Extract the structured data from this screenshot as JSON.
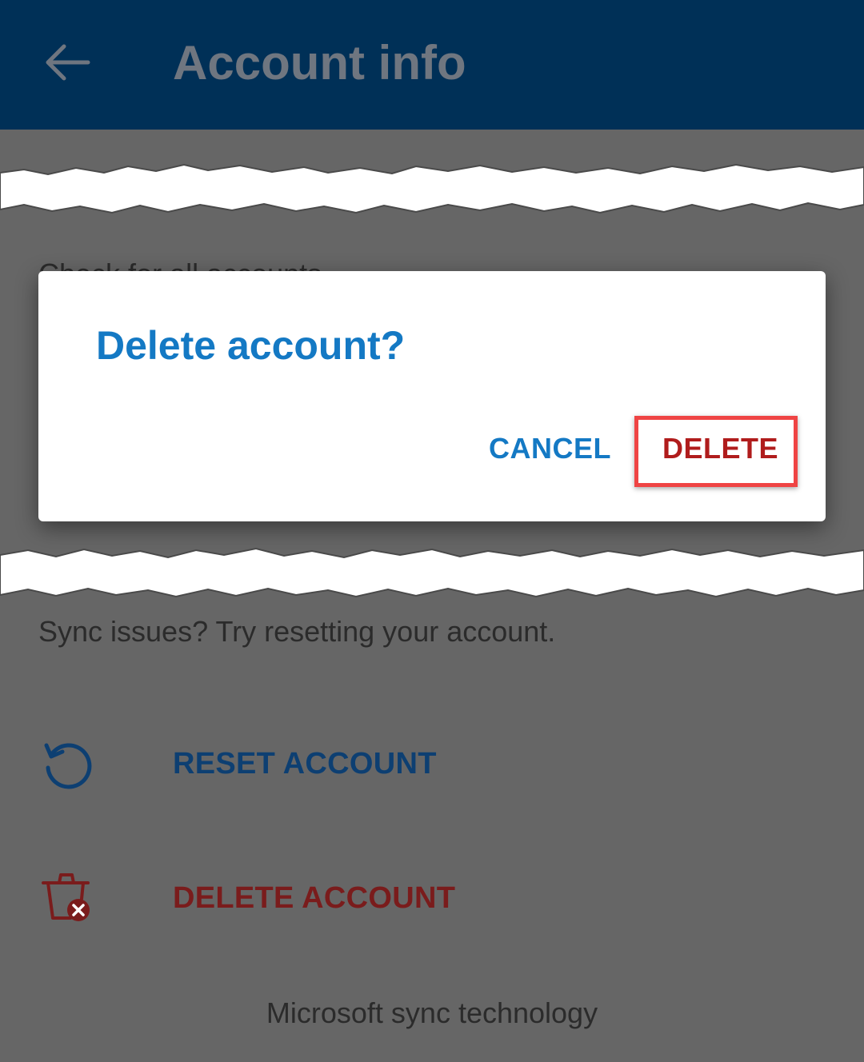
{
  "appbar": {
    "title": "Account info",
    "back_icon": "arrow-left-icon"
  },
  "background": {
    "peek_text": "Check for all accounts"
  },
  "dialog": {
    "title": "Delete account?",
    "cancel_label": "CANCEL",
    "delete_label": "DELETE",
    "highlight_color": "#ef4444"
  },
  "main": {
    "sync_hint": "Sync issues? Try resetting your account.",
    "actions": [
      {
        "label": "RESET ACCOUNT",
        "icon": "refresh-icon",
        "color": "#0d3f72"
      },
      {
        "label": "DELETE ACCOUNT",
        "icon": "trash-x-icon",
        "color": "#7a1c1c"
      }
    ],
    "footer": "Microsoft sync technology"
  },
  "colors": {
    "appbar": "#003057",
    "accent": "#1479c4",
    "danger": "#b01c1c",
    "scrim": "#666666"
  }
}
